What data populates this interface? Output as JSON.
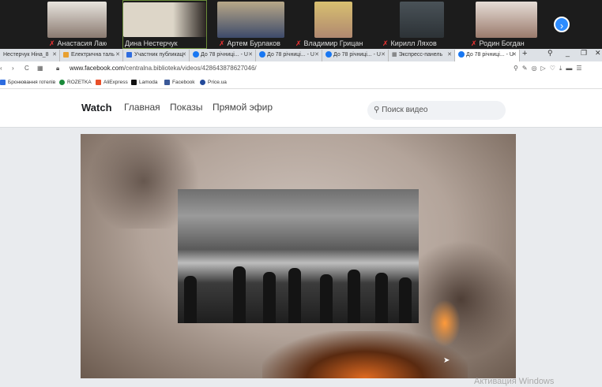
{
  "participants": [
    {
      "name": "Анастасия Лакосина",
      "muted": true
    },
    {
      "name": "Дина Нестерчук",
      "muted": false
    },
    {
      "name": "Артем Бурлаков",
      "muted": true
    },
    {
      "name": "Владимир Грицан",
      "muted": true
    },
    {
      "name": "Кирилл Ляхов",
      "muted": true
    },
    {
      "name": "Родин Богдан",
      "muted": true
    }
  ],
  "browser": {
    "tabs": [
      {
        "label": "Нестерчук Ніна_8"
      },
      {
        "label": "Електрична таль"
      },
      {
        "label": "Участник публикац"
      },
      {
        "label": "До 78 річниці... - U"
      },
      {
        "label": "До 78 річниці... - U"
      },
      {
        "label": "До 78 річниці... - U"
      },
      {
        "label": "Экспресс-панель"
      },
      {
        "label": "До 78 річниці... - U"
      }
    ],
    "url_domain": "www.facebook.com",
    "url_path": "/centralna.biblioteka/videos/428643878627046/",
    "bookmarks": [
      "Бронювання готелів",
      "ROZETKA",
      "AliExpress",
      "Lamoda",
      "Facebook",
      "Price.ua"
    ]
  },
  "facebook": {
    "watch": "Watch",
    "nav": [
      "Главная",
      "Показы",
      "Прямой эфир"
    ],
    "search_placeholder": "Поиск видео"
  },
  "os": {
    "watermark": "Активация Windows"
  }
}
